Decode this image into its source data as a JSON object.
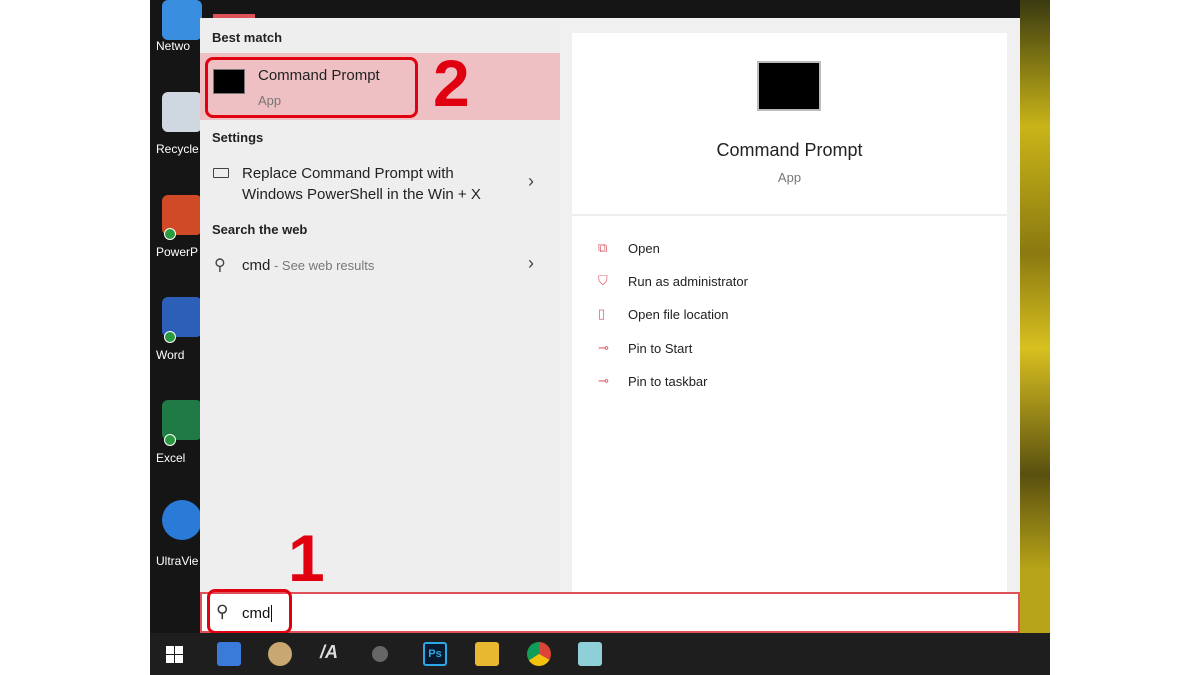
{
  "desktop": {
    "icons": [
      {
        "label": "Netwo",
        "color": "#3a8ee0"
      },
      {
        "label": "Recycle",
        "color": "#cfd8e0"
      },
      {
        "label": "PowerP",
        "color": "#d04a28"
      },
      {
        "label": "Word",
        "color": "#2b5fb8"
      },
      {
        "label": "Excel",
        "color": "#1f7a45"
      },
      {
        "label": "UltraVie",
        "color": "#2a7ad8"
      }
    ]
  },
  "start_menu": {
    "best_match_header": "Best match",
    "best_match": {
      "title": "Command Prompt",
      "subtitle": "App"
    },
    "settings_header": "Settings",
    "settings_item": {
      "line1": "Replace Command Prompt with",
      "line2": "Windows PowerShell in the Win + X"
    },
    "web_header": "Search the web",
    "web_item": {
      "query": "cmd",
      "suffix": " - See web results"
    },
    "preview": {
      "title": "Command Prompt",
      "subtitle": "App"
    },
    "actions": [
      {
        "label": "Open",
        "icon": "open-icon"
      },
      {
        "label": "Run as administrator",
        "icon": "shield-icon"
      },
      {
        "label": "Open file location",
        "icon": "folder-icon"
      },
      {
        "label": "Pin to Start",
        "icon": "pin-icon"
      },
      {
        "label": "Pin to taskbar",
        "icon": "pin-icon"
      }
    ]
  },
  "search": {
    "value": "cmd"
  },
  "annotations": {
    "step1": "1",
    "step2": "2",
    "color": "#e00010"
  },
  "accent": "#e0505a"
}
